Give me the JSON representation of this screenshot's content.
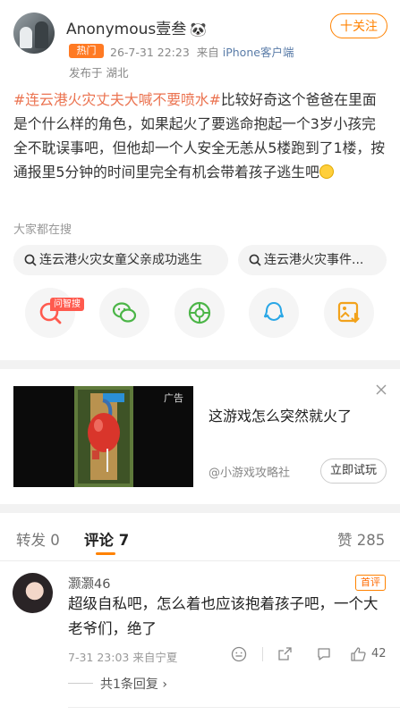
{
  "header": {
    "username": "Anonymous壹叁",
    "hot_tag": "热门",
    "time": "26-7-31 22:23",
    "source_prefix": "来自",
    "source_device": "iPhone客户端",
    "published_from": "发布于 湖北",
    "follow_label": "十关注"
  },
  "post": {
    "hashtag": "#连云港火灾丈夫大喊不要喷水#",
    "text": "比较好奇这个爸爸在里面是个什么样的角色，如果起火了要逃命抱起一个3岁小孩完全不耽误事吧，但他却一个人安全无恙从5楼跑到了1楼，按通报里5分钟的时间里完全有机会带着孩子逃生吧"
  },
  "search": {
    "heading": "大家都在搜",
    "chips": [
      "连云港火灾女童父亲成功逃生",
      "连云港火灾事件..."
    ]
  },
  "share": {
    "ai_badge": "问智搜",
    "items": [
      "ai-search",
      "wechat",
      "moments",
      "qq",
      "save-image"
    ]
  },
  "ad": {
    "tag": "广告",
    "title": "这游戏怎么突然就火了",
    "source": "@小游戏攻略社",
    "cta": "立即试玩"
  },
  "tabs": {
    "repost": "转发 0",
    "comment": "评论 7",
    "like": "赞 285"
  },
  "comment": {
    "name": "灏灏46",
    "badge": "首评",
    "text": "超级自私吧，怎么着也应该抱着孩子吧，一个大老爷们，绝了",
    "meta": "7-31 23:03  来自宁夏",
    "likes": "42",
    "reply_link": "共1条回复 ›"
  },
  "colors": {
    "accent": "#ff8200",
    "hashtag": "#eb7350"
  }
}
